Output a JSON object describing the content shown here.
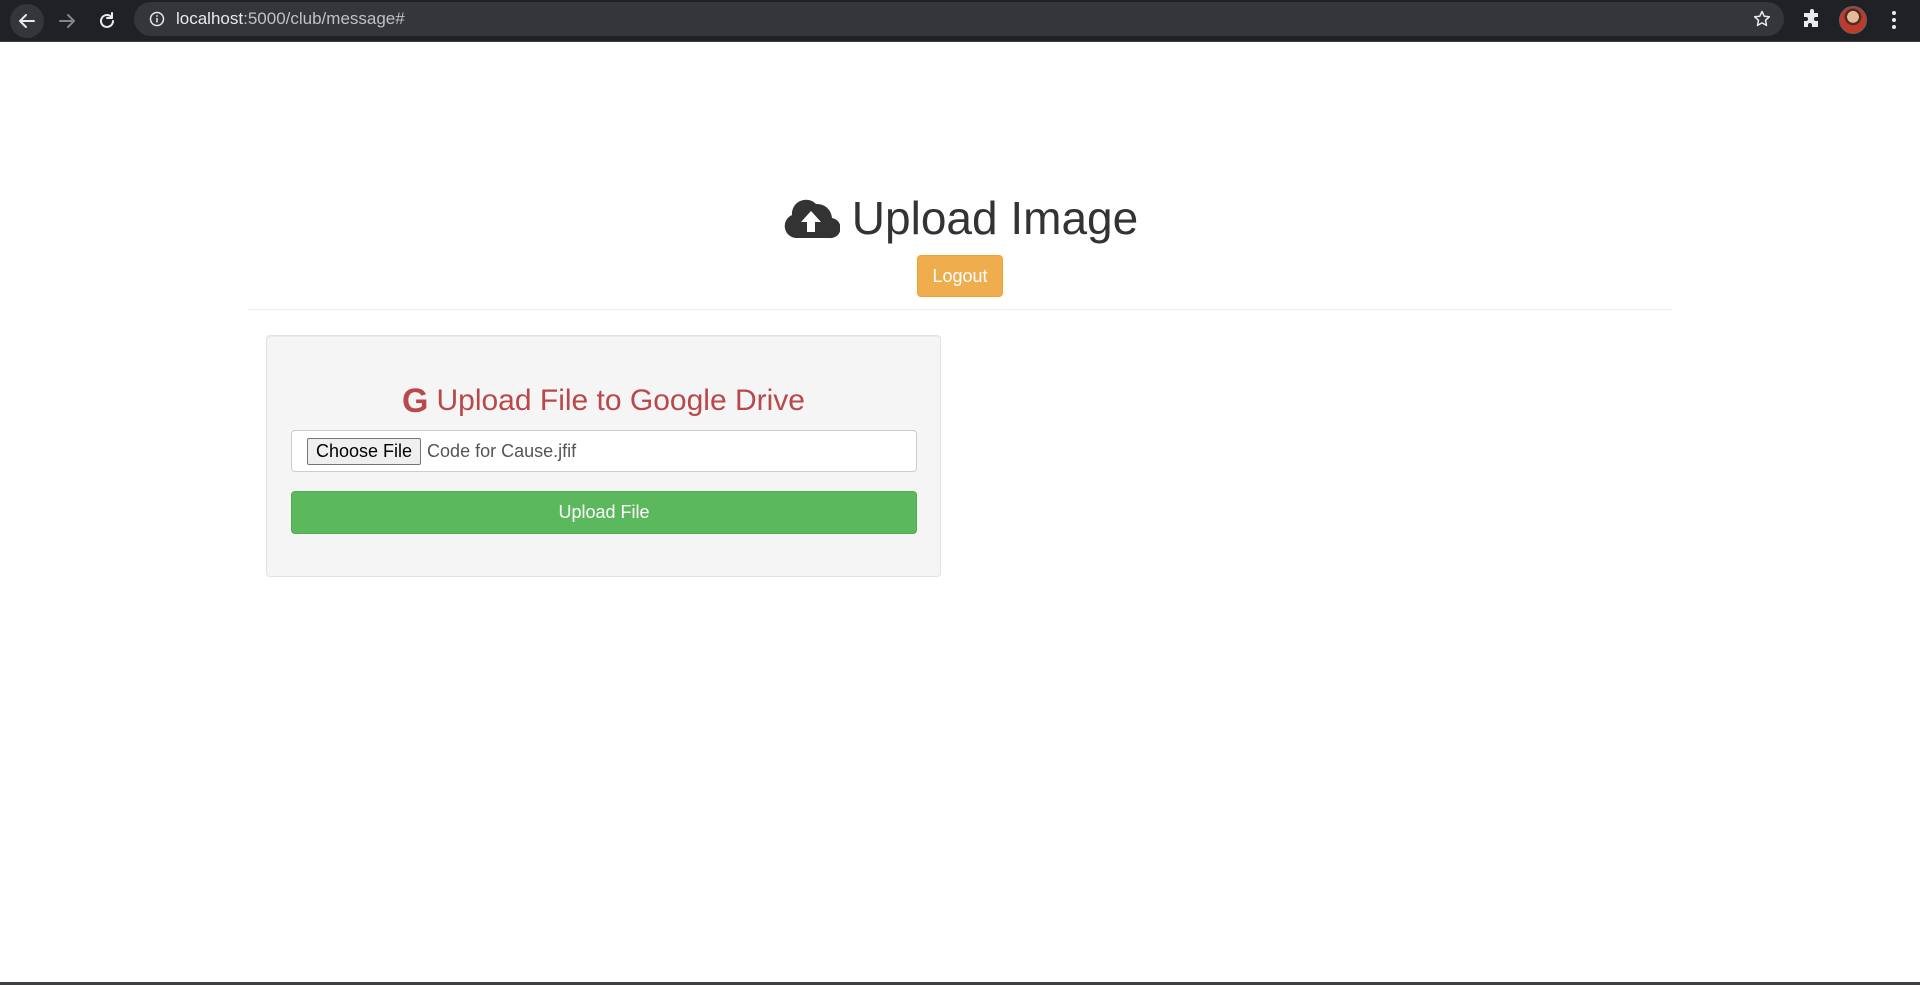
{
  "browser": {
    "url_host": "localhost",
    "url_path": ":5000/club/message#"
  },
  "header": {
    "title": "Upload Image",
    "logout_label": "Logout"
  },
  "upload_panel": {
    "title": "Upload File to Google Drive",
    "choose_file_label": "Choose File",
    "selected_file": "Code for Cause.jfif",
    "upload_label": "Upload File"
  },
  "colors": {
    "logout_button": "#f0ad4e",
    "upload_button": "#5cb85c",
    "panel_title": "#b9484a",
    "chrome_background": "#202124"
  },
  "icons": {
    "back": "arrow-left-icon",
    "forward": "arrow-right-icon",
    "reload": "reload-icon",
    "site_info": "info-icon",
    "bookmark": "star-icon",
    "extensions": "puzzle-icon",
    "menu": "kebab-menu-icon",
    "title": "cloud-upload-icon",
    "panel_title": "google-icon"
  }
}
